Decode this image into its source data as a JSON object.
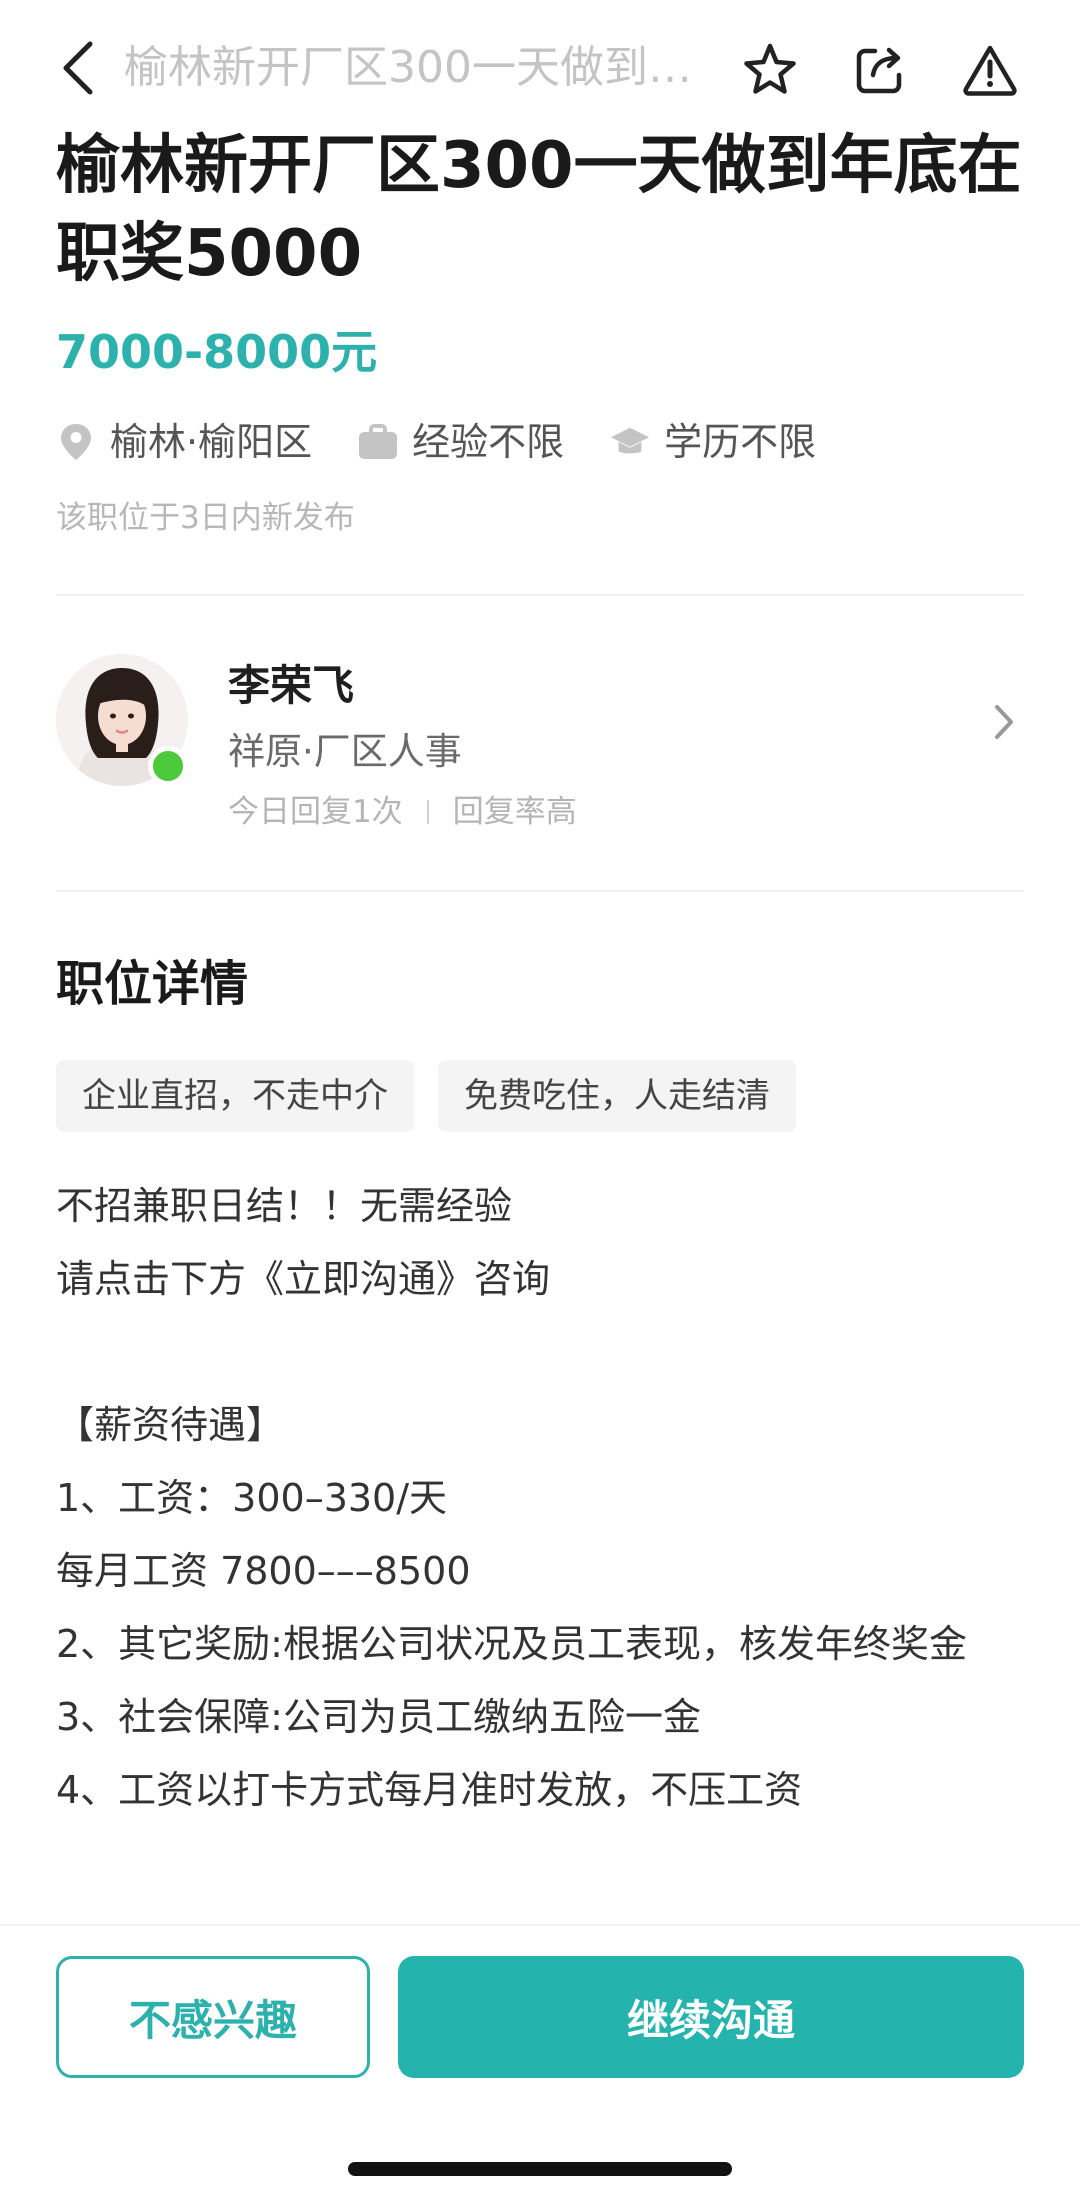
{
  "nav": {
    "title": "榆林新开厂区300一天做到…",
    "back_icon": "chevron-left-icon",
    "star_icon": "star-icon",
    "share_icon": "share-icon",
    "report_icon": "alert-icon"
  },
  "job": {
    "title": "榆林新开厂区300一天做到年底在职奖5000",
    "salary": "7000-8000元",
    "location": "榆林·榆阳区",
    "experience": "经验不限",
    "education": "学历不限",
    "posted": "该职位于3日内新发布"
  },
  "recruiter": {
    "name": "李荣飞",
    "company": "祥原·厂区人事",
    "reply_count": "今日回复1次",
    "reply_rate": "回复率高",
    "online_color": "#4cc83b"
  },
  "details": {
    "section_title": "职位详情",
    "tags": [
      "企业直招，不走中介",
      "免费吃住，人走结清"
    ],
    "lines": [
      "不招兼职日结！！无需经验",
      "请点击下方《立即沟通》咨询",
      "",
      "【薪资待遇】",
      "1、工资：300–330/天",
      "每月工资 7800–––8500",
      "2、其它奖励:根据公司状况及员工表现，核发年终奖金",
      "3、社会保障:公司为员工缴纳五险一金",
      "4、工资以打卡方式每月准时发放，不压工资"
    ]
  },
  "actions": {
    "not_interested": "不感兴趣",
    "continue_chat": "继续沟通"
  },
  "colors": {
    "accent": "#2cb1ad",
    "primary_button": "#25b3ad"
  }
}
